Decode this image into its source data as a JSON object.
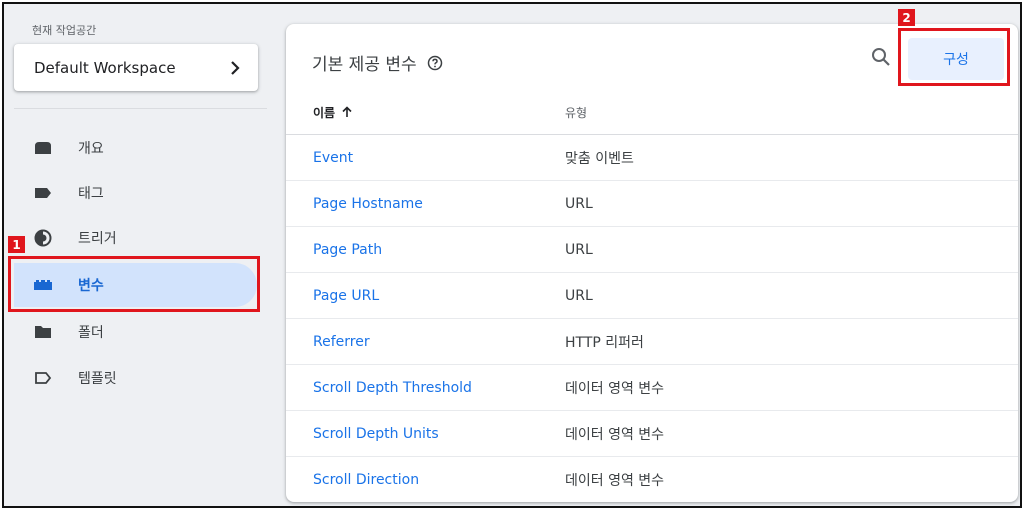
{
  "workspace": {
    "label": "현재 작업공간",
    "name": "Default Workspace"
  },
  "nav": {
    "items": [
      {
        "label": "개요",
        "icon": "overview-icon"
      },
      {
        "label": "태그",
        "icon": "tag-icon"
      },
      {
        "label": "트리거",
        "icon": "trigger-icon"
      },
      {
        "label": "변수",
        "icon": "variables-icon",
        "active": true
      },
      {
        "label": "폴더",
        "icon": "folder-icon"
      },
      {
        "label": "템플릿",
        "icon": "template-icon"
      }
    ]
  },
  "annotations": {
    "one": "1",
    "two": "2"
  },
  "main": {
    "title": "기본 제공 변수",
    "configure_label": "구성",
    "columns": {
      "name": "이름",
      "type": "유형"
    },
    "rows": [
      {
        "name": "Event",
        "type": "맞춤 이벤트"
      },
      {
        "name": "Page Hostname",
        "type": "URL"
      },
      {
        "name": "Page Path",
        "type": "URL"
      },
      {
        "name": "Page URL",
        "type": "URL"
      },
      {
        "name": "Referrer",
        "type": "HTTP 리퍼러"
      },
      {
        "name": "Scroll Depth Threshold",
        "type": "데이터 영역 변수"
      },
      {
        "name": "Scroll Depth Units",
        "type": "데이터 영역 변수"
      },
      {
        "name": "Scroll Direction",
        "type": "데이터 영역 변수"
      }
    ]
  },
  "colors": {
    "accent": "#1a73e8",
    "active_bg": "#d2e3fc",
    "annotation": "#e0161d"
  }
}
